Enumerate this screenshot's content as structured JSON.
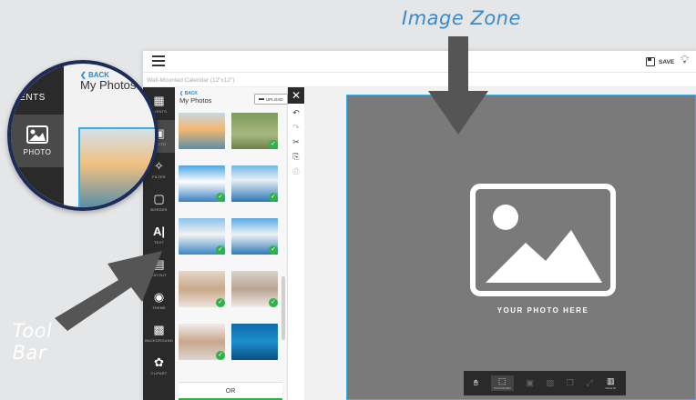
{
  "annotations": {
    "image_zone": "Image Zone",
    "tool_bar": "Tool Bar"
  },
  "header": {
    "save_label": "SAVE",
    "document_title": "Wall-Mounted Calendar (12\"x12\")"
  },
  "toolbar": {
    "items": [
      {
        "label": "EVENTS",
        "icon": "calendar-icon"
      },
      {
        "label": "PHOTO",
        "icon": "photo-icon",
        "active": true
      },
      {
        "label": "FILTER",
        "icon": "magic-wand-icon"
      },
      {
        "label": "BORDER",
        "icon": "border-icon"
      },
      {
        "label": "TEXT",
        "icon": "text-icon"
      },
      {
        "label": "LAYOUT",
        "icon": "layout-icon"
      },
      {
        "label": "THEME",
        "icon": "palette-icon"
      },
      {
        "label": "BACKGROUND",
        "icon": "background-icon"
      },
      {
        "label": "CLIPART",
        "icon": "flower-icon"
      }
    ]
  },
  "panel": {
    "back_label": "BACK",
    "title": "My Photos",
    "upload_label": "UPLOAD",
    "or_label": "OR"
  },
  "canvas": {
    "placeholder_text": "YOUR PHOTO HERE",
    "photo_tools": [
      {
        "label": "",
        "icon": "hand-icon"
      },
      {
        "label": "TRANSFORM",
        "icon": "transform-icon",
        "active": true
      },
      {
        "label": "",
        "icon": "replace-icon"
      },
      {
        "label": "",
        "icon": "layer-icon"
      },
      {
        "label": "",
        "icon": "copy-icon"
      },
      {
        "label": "",
        "icon": "expand-icon"
      },
      {
        "label": "DELETE",
        "icon": "trash-icon"
      }
    ]
  },
  "magnifier": {
    "events_label": "VENTS",
    "photo_label": "PHOTO",
    "back_label": "BACK",
    "title": "My Photos"
  },
  "colors": {
    "accent": "#3ab0e6",
    "check_green": "#2db34a",
    "toolbar_bg": "#2a2a2a",
    "annotation_text": "#3a89c9"
  }
}
